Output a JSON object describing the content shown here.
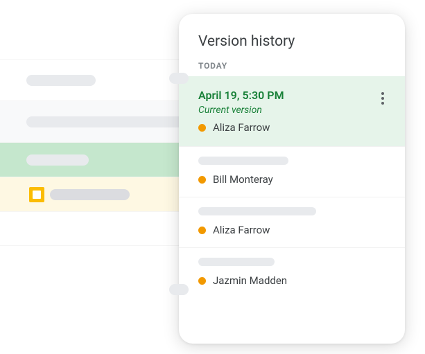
{
  "panel": {
    "title": "Version history",
    "section_label": "TODAY"
  },
  "versions": [
    {
      "timestamp": "April 19, 5:30 PM",
      "subtitle": "Current version",
      "editor": "Aliza Farrow",
      "current": true
    },
    {
      "editor": "Bill Monteray"
    },
    {
      "editor": "Aliza Farrow"
    },
    {
      "editor": "Jazmin Madden"
    }
  ],
  "colors": {
    "accent_green": "#188038",
    "highlight_bg": "#e6f4ea",
    "editor_dot": "#f29900",
    "placeholder": "#e8eaed"
  }
}
